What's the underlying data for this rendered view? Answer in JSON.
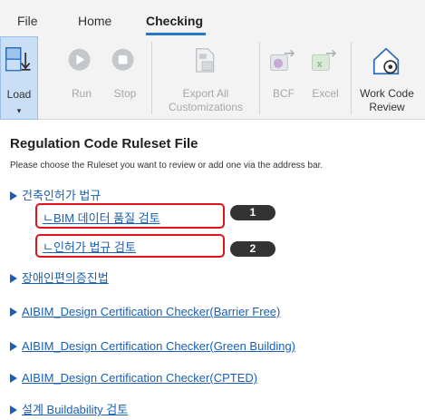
{
  "tabs": [
    "File",
    "Home",
    "Checking"
  ],
  "ribbon": {
    "load": "Load",
    "run": "Run",
    "stop": "Stop",
    "export_line1": "Export All",
    "export_line2": "Customizations",
    "bcf": "BCF",
    "excel": "Excel",
    "review_line1": "Work Code",
    "review_line2": "Review",
    "load_dropdown": "▾"
  },
  "panel": {
    "heading": "Regulation Code Ruleset File",
    "hint": "Please choose the Ruleset you want to review or add one via the address bar.",
    "tree": [
      {
        "label": "건축인허가 법규"
      },
      {
        "label": "장애인편의증진법"
      },
      {
        "label": "AIBIM_Design Certification Checker(Barrier Free)"
      },
      {
        "label": "AIBIM_Design Certification Checker(Green Building)"
      },
      {
        "label": "AIBIM_Design Certification Checker(CPTED)"
      },
      {
        "label": "설계 Buildability 검토"
      }
    ],
    "sub_items": [
      "ㄴBIM 데이터 품질 검토",
      "ㄴ인허가 법규 검토"
    ]
  },
  "badges": [
    "1",
    "2"
  ],
  "colors": {
    "accent": "#2b77c7",
    "link": "#1a5fb4",
    "highlight": "#e0121c",
    "badge": "#333333"
  }
}
